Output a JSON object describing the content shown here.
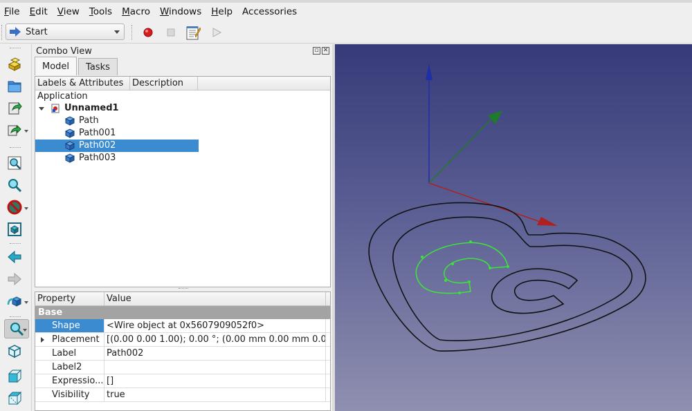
{
  "menu": [
    "File",
    "Edit",
    "View",
    "Tools",
    "Macro",
    "Windows",
    "Help",
    "Accessories"
  ],
  "menu_underline": [
    "F",
    "E",
    "V",
    "T",
    "M",
    "W",
    "H",
    ""
  ],
  "toolbar": {
    "workbench": "Start"
  },
  "combo": {
    "title": "Combo View",
    "tabs": [
      "Model",
      "Tasks"
    ],
    "active_tab": "Model"
  },
  "tree": {
    "columns": [
      "Labels & Attributes",
      "Description"
    ],
    "root": "Application",
    "document": "Unnamed1",
    "items": [
      "Path",
      "Path001",
      "Path002",
      "Path003"
    ],
    "selected": "Path002"
  },
  "properties": {
    "columns": [
      "Property",
      "Value"
    ],
    "group": "Base",
    "rows": [
      {
        "name": "Shape",
        "value": "<Wire object at 0x5607909052f0>"
      },
      {
        "name": "Placement",
        "value": "[(0.00 0.00 1.00); 0.00 °; (0.00 mm  0.00 mm  0.0..."
      },
      {
        "name": "Label",
        "value": "Path002"
      },
      {
        "name": "Label2",
        "value": ""
      },
      {
        "name": "Expressio...",
        "value": "[]"
      },
      {
        "name": "Visibility",
        "value": "true"
      }
    ]
  },
  "colors": {
    "selection": "#3a8bd0",
    "view_top": "#363a78",
    "view_bottom": "#8f90b0",
    "axis_x": "#b02020",
    "axis_y": "#1f7a2a",
    "axis_z": "#1f2fa8",
    "selected_path": "#3ee03e"
  }
}
